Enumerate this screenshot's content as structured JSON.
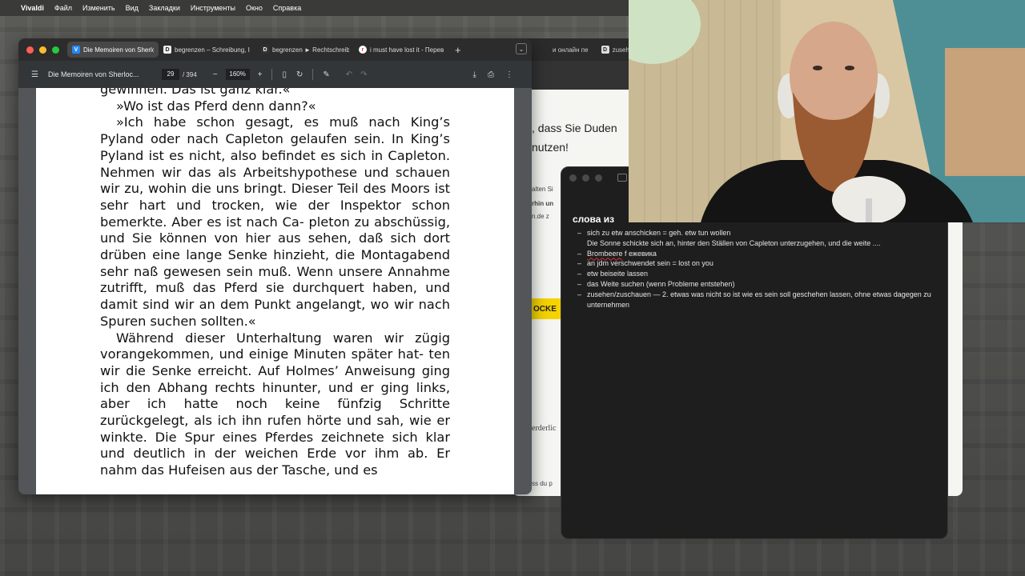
{
  "menubar": {
    "app_name": "Vivaldi",
    "items": [
      "Файл",
      "Изменить",
      "Вид",
      "Закладки",
      "Инструменты",
      "Окно",
      "Справка"
    ]
  },
  "browser": {
    "tabs": [
      {
        "label": "Die Memoiren von Sherloc",
        "favicon": "vk-icon",
        "active": true
      },
      {
        "label": "begrenzen – Schreibung, I",
        "favicon": "duden-icon",
        "active": false
      },
      {
        "label": "begrenzen ► Rechtschreib",
        "favicon": "dwds-icon",
        "active": false
      },
      {
        "label": "i must have lost it - Переве",
        "favicon": "reverso-icon",
        "active": false
      }
    ],
    "back_tabs": [
      {
        "label": "и онлайн пе"
      },
      {
        "label": "zusehen – Sc"
      }
    ],
    "back_page": {
      "line1": ", dass Sie Duden",
      "line2": "nutzen!",
      "small1": "alten Si",
      "small2": "rhin un",
      "small3": "n.de z",
      "yellow_text": "OCKE",
      "small4": "erderlic",
      "small5": "ss du p"
    }
  },
  "pdf": {
    "title": "Die Memoiren von Sherloc...",
    "page_current": "29",
    "page_total": "/ 394",
    "zoom": "160%",
    "paragraphs": [
      {
        "text": "gewinnen. Das ist ganz klar.«",
        "indent": false
      },
      {
        "text": "»Wo ist das Pferd denn dann?«",
        "indent": true
      },
      {
        "text": "»Ich habe schon gesagt, es muß nach King’s Pyland oder nach Capleton gelaufen sein. In King’s Pyland ist es nicht, also befindet es sich in Capleton. Nehmen wir das als Arbeitshypothese und schauen wir zu, wohin die uns bringt. Dieser Teil des Moors ist sehr hart und trocken, wie der Inspektor schon bemerkte. Aber es ist nach Ca- pleton zu abschüssig, und Sie können von hier aus sehen, daß sich dort drüben eine lange Senke hinzieht, die Montagabend sehr naß gewesen sein muß. Wenn unsere Annahme zutrifft, muß das Pferd sie durchquert haben, und damit sind wir an dem Punkt angelangt, wo wir nach Spuren suchen sollten.«",
        "indent": true
      },
      {
        "text": "Während dieser Unterhaltung waren wir zügig vorangekommen, und einige Minuten später hat- ten wir die Senke erreicht. Auf Holmes’ Anweisung ging ich den Abhang rechts hinunter, und er ging links, aber ich hatte noch keine fünfzig Schritte zurückgelegt, als ich ihn rufen hörte und sah, wie er winkte. Die Spur eines Pferdes zeichnete sich klar und deutlich in der weichen Erde vor ihm ab. Er nahm das Hufeisen aus der Tasche, und es",
        "indent": true
      }
    ]
  },
  "notes": {
    "title": "слова из",
    "items": [
      {
        "main": "sich zu etw anschicken = geh. etw tun wollen",
        "sub": "Die Sonne schickte sich an, hinter den Ställen von Capleton unterzugehen, und die weite ....",
        "wavy": ""
      },
      {
        "main": " f ежевика",
        "sub": "",
        "wavy": "Brombeere"
      },
      {
        "main": "an jdm verschwendet sein = lost on you",
        "sub": "",
        "wavy": ""
      },
      {
        "main": "etw beiseite lassen",
        "sub": "",
        "wavy": ""
      },
      {
        "main": "das Weite suchen (wenn Probleme entstehen)",
        "sub": "",
        "wavy": ""
      },
      {
        "main": "zusehen/zuschauen — 2. etwas was nicht so ist wie es sein soll geschehen lassen, ohne etwas dagegen zu unternehmen",
        "sub": "",
        "wavy": ""
      }
    ]
  },
  "colors": {
    "accent_vk": "#2787f5",
    "traffic_red": "#fe5f57",
    "traffic_yellow": "#febc2e",
    "traffic_green": "#28c840",
    "duden_yellow": "#f5d300"
  }
}
